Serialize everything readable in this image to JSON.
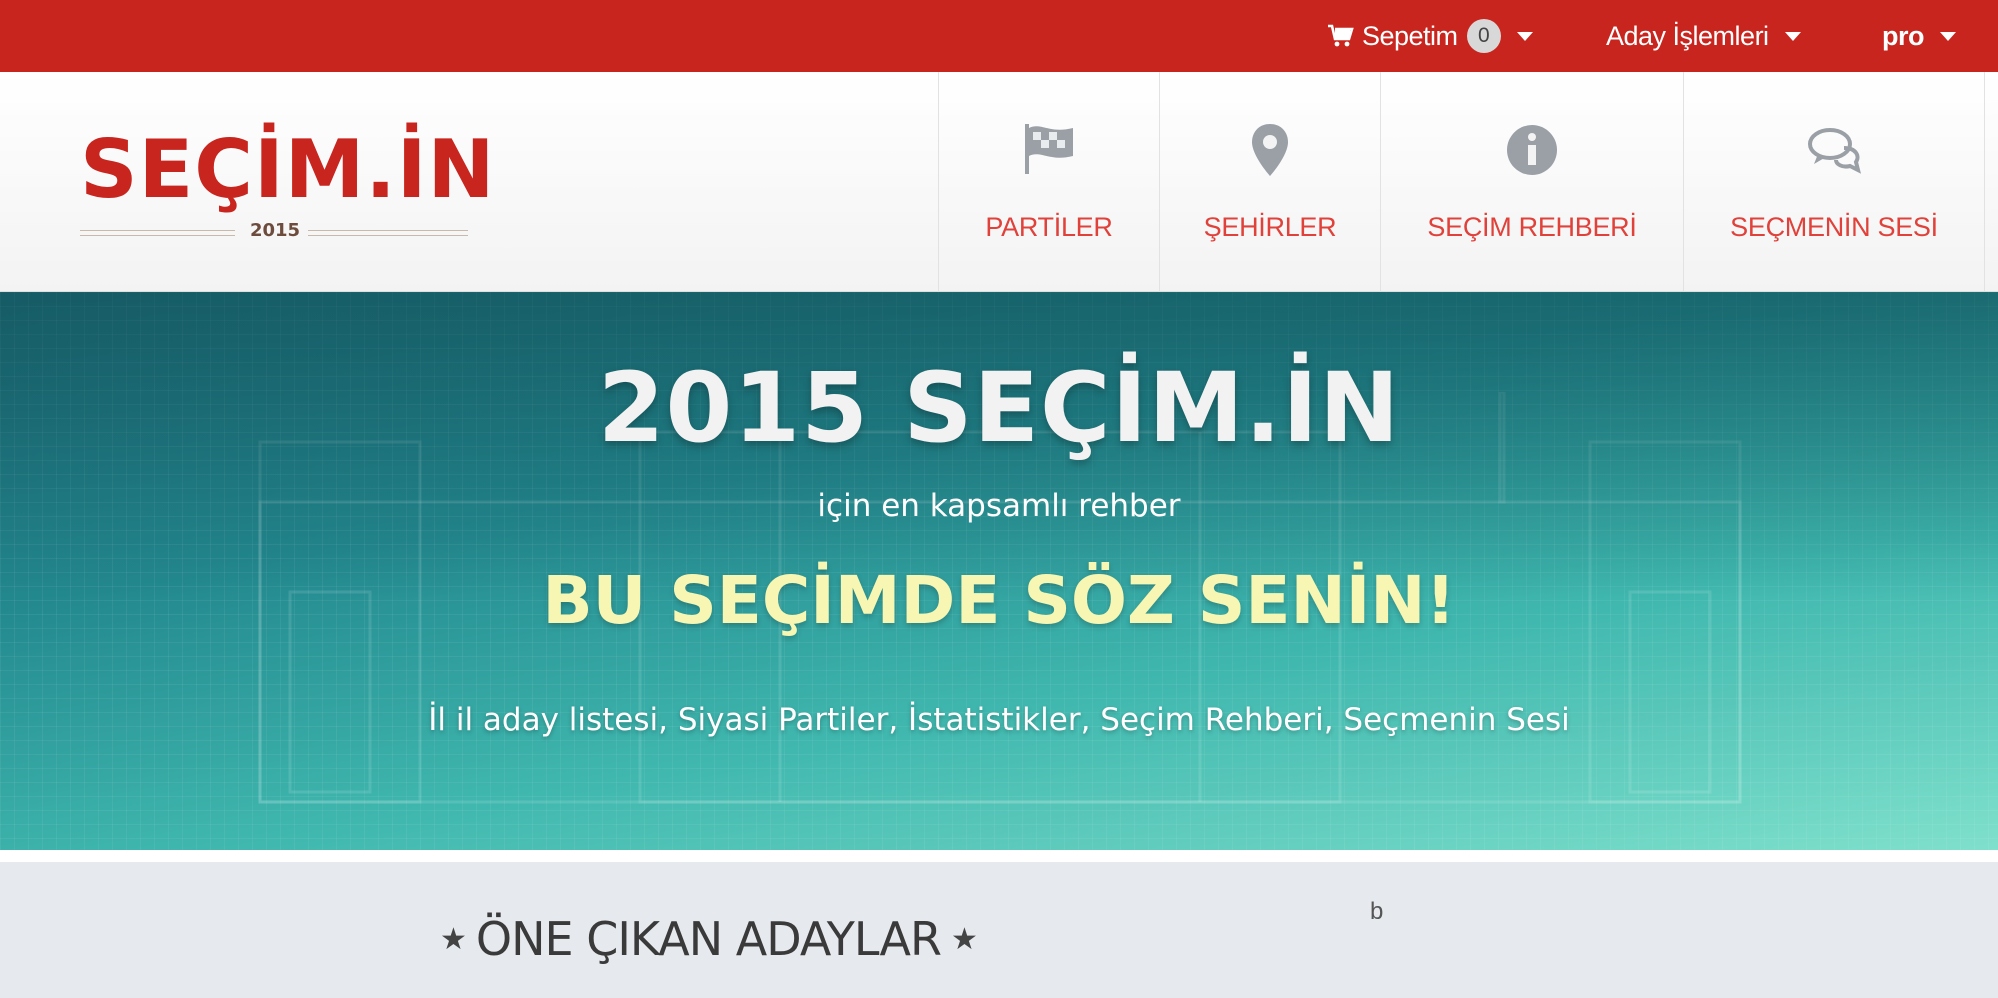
{
  "topbar": {
    "cart_label": "Sepetim",
    "cart_count": "0",
    "candidate_ops_label": "Aday İşlemleri",
    "user_label": "pro"
  },
  "logo": {
    "word": "SEÇİM.İN",
    "year": "2015"
  },
  "nav": [
    {
      "label": "PARTİLER",
      "icon": "flag-icon"
    },
    {
      "label": "ŞEHİRLER",
      "icon": "map-marker-icon"
    },
    {
      "label": "SEÇİM REHBERİ",
      "icon": "info-icon"
    },
    {
      "label": "SEÇMENİN SESİ",
      "icon": "comments-icon"
    }
  ],
  "hero": {
    "title": "2015 SEÇİM.İN",
    "subtitle": "için en kapsamlı rehber",
    "slogan": "BU SEÇİMDE SÖZ SENİN!",
    "description": "İl il aday listesi, Siyasi Partiler, İstatistikler, Seçim Rehberi, Seçmenin Sesi"
  },
  "section": {
    "title": "ÖNE ÇIKAN ADAYLAR",
    "side_text": "b"
  },
  "colors": {
    "brand_red": "#c8251f",
    "nav_label": "#e0413a",
    "slogan": "#f7f6b2"
  }
}
